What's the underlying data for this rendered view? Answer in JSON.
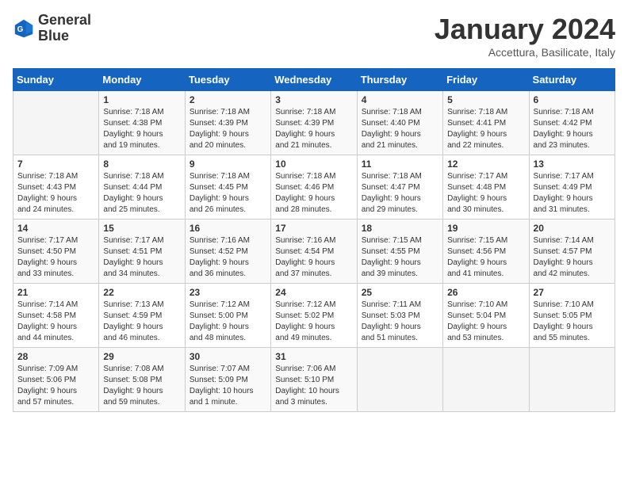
{
  "logo": {
    "line1": "General",
    "line2": "Blue"
  },
  "title": "January 2024",
  "subtitle": "Accettura, Basilicate, Italy",
  "days_of_week": [
    "Sunday",
    "Monday",
    "Tuesday",
    "Wednesday",
    "Thursday",
    "Friday",
    "Saturday"
  ],
  "weeks": [
    [
      {
        "day": "",
        "info": ""
      },
      {
        "day": "1",
        "info": "Sunrise: 7:18 AM\nSunset: 4:38 PM\nDaylight: 9 hours\nand 19 minutes."
      },
      {
        "day": "2",
        "info": "Sunrise: 7:18 AM\nSunset: 4:39 PM\nDaylight: 9 hours\nand 20 minutes."
      },
      {
        "day": "3",
        "info": "Sunrise: 7:18 AM\nSunset: 4:39 PM\nDaylight: 9 hours\nand 21 minutes."
      },
      {
        "day": "4",
        "info": "Sunrise: 7:18 AM\nSunset: 4:40 PM\nDaylight: 9 hours\nand 21 minutes."
      },
      {
        "day": "5",
        "info": "Sunrise: 7:18 AM\nSunset: 4:41 PM\nDaylight: 9 hours\nand 22 minutes."
      },
      {
        "day": "6",
        "info": "Sunrise: 7:18 AM\nSunset: 4:42 PM\nDaylight: 9 hours\nand 23 minutes."
      }
    ],
    [
      {
        "day": "7",
        "info": "Sunrise: 7:18 AM\nSunset: 4:43 PM\nDaylight: 9 hours\nand 24 minutes."
      },
      {
        "day": "8",
        "info": "Sunrise: 7:18 AM\nSunset: 4:44 PM\nDaylight: 9 hours\nand 25 minutes."
      },
      {
        "day": "9",
        "info": "Sunrise: 7:18 AM\nSunset: 4:45 PM\nDaylight: 9 hours\nand 26 minutes."
      },
      {
        "day": "10",
        "info": "Sunrise: 7:18 AM\nSunset: 4:46 PM\nDaylight: 9 hours\nand 28 minutes."
      },
      {
        "day": "11",
        "info": "Sunrise: 7:18 AM\nSunset: 4:47 PM\nDaylight: 9 hours\nand 29 minutes."
      },
      {
        "day": "12",
        "info": "Sunrise: 7:17 AM\nSunset: 4:48 PM\nDaylight: 9 hours\nand 30 minutes."
      },
      {
        "day": "13",
        "info": "Sunrise: 7:17 AM\nSunset: 4:49 PM\nDaylight: 9 hours\nand 31 minutes."
      }
    ],
    [
      {
        "day": "14",
        "info": "Sunrise: 7:17 AM\nSunset: 4:50 PM\nDaylight: 9 hours\nand 33 minutes."
      },
      {
        "day": "15",
        "info": "Sunrise: 7:17 AM\nSunset: 4:51 PM\nDaylight: 9 hours\nand 34 minutes."
      },
      {
        "day": "16",
        "info": "Sunrise: 7:16 AM\nSunset: 4:52 PM\nDaylight: 9 hours\nand 36 minutes."
      },
      {
        "day": "17",
        "info": "Sunrise: 7:16 AM\nSunset: 4:54 PM\nDaylight: 9 hours\nand 37 minutes."
      },
      {
        "day": "18",
        "info": "Sunrise: 7:15 AM\nSunset: 4:55 PM\nDaylight: 9 hours\nand 39 minutes."
      },
      {
        "day": "19",
        "info": "Sunrise: 7:15 AM\nSunset: 4:56 PM\nDaylight: 9 hours\nand 41 minutes."
      },
      {
        "day": "20",
        "info": "Sunrise: 7:14 AM\nSunset: 4:57 PM\nDaylight: 9 hours\nand 42 minutes."
      }
    ],
    [
      {
        "day": "21",
        "info": "Sunrise: 7:14 AM\nSunset: 4:58 PM\nDaylight: 9 hours\nand 44 minutes."
      },
      {
        "day": "22",
        "info": "Sunrise: 7:13 AM\nSunset: 4:59 PM\nDaylight: 9 hours\nand 46 minutes."
      },
      {
        "day": "23",
        "info": "Sunrise: 7:12 AM\nSunset: 5:00 PM\nDaylight: 9 hours\nand 48 minutes."
      },
      {
        "day": "24",
        "info": "Sunrise: 7:12 AM\nSunset: 5:02 PM\nDaylight: 9 hours\nand 49 minutes."
      },
      {
        "day": "25",
        "info": "Sunrise: 7:11 AM\nSunset: 5:03 PM\nDaylight: 9 hours\nand 51 minutes."
      },
      {
        "day": "26",
        "info": "Sunrise: 7:10 AM\nSunset: 5:04 PM\nDaylight: 9 hours\nand 53 minutes."
      },
      {
        "day": "27",
        "info": "Sunrise: 7:10 AM\nSunset: 5:05 PM\nDaylight: 9 hours\nand 55 minutes."
      }
    ],
    [
      {
        "day": "28",
        "info": "Sunrise: 7:09 AM\nSunset: 5:06 PM\nDaylight: 9 hours\nand 57 minutes."
      },
      {
        "day": "29",
        "info": "Sunrise: 7:08 AM\nSunset: 5:08 PM\nDaylight: 9 hours\nand 59 minutes."
      },
      {
        "day": "30",
        "info": "Sunrise: 7:07 AM\nSunset: 5:09 PM\nDaylight: 10 hours\nand 1 minute."
      },
      {
        "day": "31",
        "info": "Sunrise: 7:06 AM\nSunset: 5:10 PM\nDaylight: 10 hours\nand 3 minutes."
      },
      {
        "day": "",
        "info": ""
      },
      {
        "day": "",
        "info": ""
      },
      {
        "day": "",
        "info": ""
      }
    ]
  ]
}
